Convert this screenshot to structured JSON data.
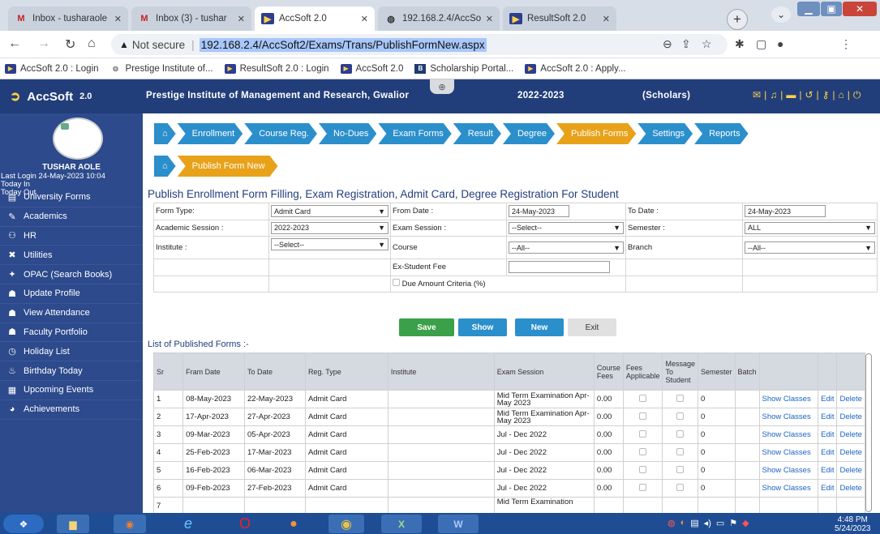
{
  "browser": {
    "tabs": [
      {
        "label": "Inbox - tusharaole",
        "icon": "gmail-icon"
      },
      {
        "label": "Inbox (3) - tushar",
        "icon": "gmail-icon"
      },
      {
        "label": "AccSoft 2.0",
        "icon": "accsoft-icon"
      },
      {
        "label": "192.168.2.4/AccSo",
        "icon": "globe-icon"
      },
      {
        "label": "ResultSoft 2.0",
        "icon": "accsoft-icon"
      }
    ],
    "security_label": "Not secure",
    "url": "192.168.2.4/AccSoft2/Exams/Trans/PublishFormNew.aspx",
    "bookmarks": [
      "AccSoft 2.0 : Login",
      "Prestige Institute of...",
      "ResultSoft 2.0 : Login",
      "AccSoft 2.0",
      "Scholarship Portal...",
      "AccSoft 2.0 : Apply..."
    ]
  },
  "header": {
    "app_name": "AccSoft",
    "app_version": "2.0",
    "institute": "Prestige Institute of Management and Research, Gwalior",
    "session": "2022-2023",
    "campus": "(Scholars)"
  },
  "sidebar": {
    "user_name": "TUSHAR AOLE",
    "last_login": "Last Login  24-May-2023 10:04",
    "today_in": "Today In",
    "today_out": "Today Out",
    "items": [
      {
        "label": "University Forms",
        "icon": "document-icon"
      },
      {
        "label": "Academics",
        "icon": "pen-icon"
      },
      {
        "label": "HR",
        "icon": "people-icon"
      },
      {
        "label": "Utilities",
        "icon": "tools-icon"
      },
      {
        "label": "OPAC (Search Books)",
        "icon": "book-icon"
      },
      {
        "label": "Update Profile",
        "icon": "user-icon"
      },
      {
        "label": "View Attendance",
        "icon": "user-icon"
      },
      {
        "label": "Faculty Portfolio",
        "icon": "user-icon"
      },
      {
        "label": "Holiday List",
        "icon": "clock-icon"
      },
      {
        "label": "Birthday Today",
        "icon": "cake-icon"
      },
      {
        "label": "Upcoming Events",
        "icon": "calendar-icon"
      },
      {
        "label": "Achievements",
        "icon": "pie-icon"
      }
    ]
  },
  "nav": {
    "items": [
      "Enrollment",
      "Course Reg.",
      "No-Dues",
      "Exam Forms",
      "Result",
      "Degree",
      "Publish Forms",
      "Settings",
      "Reports"
    ],
    "active": "Publish Forms",
    "sub_item": "Publish Form New"
  },
  "form": {
    "title": "Publish Enrollment Form Filling, Exam Registration, Admit Card, Degree Registration For Student",
    "form_type_label": "Form Type:",
    "form_type_value": "Admit Card",
    "from_date_label": "From Date :",
    "from_date_value": "24-May-2023",
    "to_date_label": "To Date :",
    "to_date_value": "24-May-2023",
    "academic_session_label": "Academic Session :",
    "academic_session_value": "2022-2023",
    "exam_session_label": "Exam Session :",
    "exam_session_value": "--Select--",
    "semester_label": "Semester :",
    "semester_value": "ALL",
    "institute_label": "Institute :",
    "institute_value": "--Select--",
    "course_label": "Course",
    "course_value": "--All--",
    "branch_label": "Branch",
    "branch_value": "--All--",
    "ex_student_fee_label": "Ex-Student Fee",
    "ex_student_fee_value": "",
    "due_amount_label": "Due Amount Criteria (%)"
  },
  "buttons": {
    "save": "Save",
    "show": "Show",
    "new": "New",
    "exit": "Exit"
  },
  "list": {
    "label": "List of Published Forms :-",
    "columns": [
      "Sr",
      "Fram Date",
      "To Date",
      "Reg. Type",
      "Institute",
      "Exam Session",
      "Course Fees",
      "Fees Applicable",
      "Message To Student",
      "Semester",
      "Batch",
      "",
      "",
      ""
    ],
    "rows": [
      {
        "sr": "1",
        "from": "08-May-2023",
        "to": "22-May-2023",
        "type": "Admit Card",
        "institute": "",
        "session": "Mid Term Examination Apr-May 2023",
        "fees": "0.00",
        "semester": "0"
      },
      {
        "sr": "2",
        "from": "17-Apr-2023",
        "to": "27-Apr-2023",
        "type": "Admit Card",
        "institute": "",
        "session": "Mid Term Examination Apr-May 2023",
        "fees": "0.00",
        "semester": "0"
      },
      {
        "sr": "3",
        "from": "09-Mar-2023",
        "to": "05-Apr-2023",
        "type": "Admit Card",
        "institute": "",
        "session": "Jul - Dec 2022",
        "fees": "0.00",
        "semester": "0"
      },
      {
        "sr": "4",
        "from": "25-Feb-2023",
        "to": "17-Mar-2023",
        "type": "Admit Card",
        "institute": "",
        "session": "Jul - Dec 2022",
        "fees": "0.00",
        "semester": "0"
      },
      {
        "sr": "5",
        "from": "16-Feb-2023",
        "to": "06-Mar-2023",
        "type": "Admit Card",
        "institute": "",
        "session": "Jul - Dec 2022",
        "fees": "0.00",
        "semester": "0"
      },
      {
        "sr": "6",
        "from": "09-Feb-2023",
        "to": "27-Feb-2023",
        "type": "Admit Card",
        "institute": "",
        "session": "Jul - Dec 2022",
        "fees": "0.00",
        "semester": "0"
      },
      {
        "sr": "7",
        "from": "",
        "to": "",
        "type": "",
        "institute": "",
        "session": "Mid Term Examination",
        "fees": "",
        "semester": ""
      }
    ],
    "action_show": "Show Classes",
    "action_edit": "Edit",
    "action_delete": "Delete"
  },
  "taskbar": {
    "time": "4:48 PM",
    "date": "5/24/2023"
  }
}
